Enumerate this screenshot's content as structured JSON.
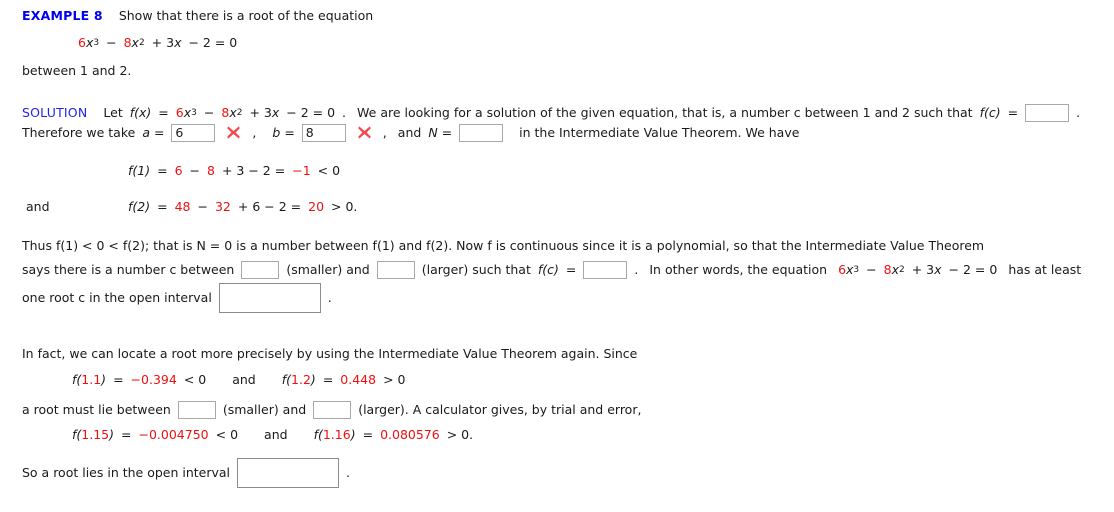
{
  "meta": {
    "colors": {
      "heading_blue": "#0000ee",
      "label_blue": "#2222ee",
      "accent_red": "#ee1111",
      "x_mark_red": "#f4484c",
      "input_border": "#a8a8a8",
      "text": "#1a1a1a",
      "background": "#ffffff"
    }
  },
  "example": {
    "label": "EXAMPLE 8",
    "prompt": "Show that there is a root of the equation",
    "equation": {
      "c1": "6",
      "t1": "x",
      "e1": "3",
      "op1": "−",
      "c2": "8",
      "t2": "x",
      "e2": "2",
      "op2": "+ 3",
      "t3": "x",
      "op3": "− 2 = 0"
    },
    "between": "between 1 and 2."
  },
  "solution": {
    "label": "SOLUTION",
    "let_text": "Let",
    "fx": "f(x)",
    "eq": "=",
    "looking_text": "We are looking for a solution of the given equation, that is, a number c between 1 and 2 such that",
    "fc": "f(c)",
    "fc_value": "",
    "trailing_period": ".",
    "therefore_text": "Therefore we take",
    "a_label": "a =",
    "a_value": "6",
    "a_status": "incorrect",
    "comma1": ",",
    "b_label": "b =",
    "b_value": "8",
    "b_status": "incorrect",
    "comma2": ",",
    "and_text": "and",
    "N_label": "N =",
    "N_value": "",
    "ivt_text": "in the Intermediate Value Theorem. We have"
  },
  "evaluations": {
    "f1": {
      "fn": "f(1)",
      "eq": "=",
      "terms": [
        "6",
        "−",
        "8",
        "+ 3 − 2 ="
      ],
      "result": "−1",
      "compare": "< 0"
    },
    "and_word": "and",
    "f2": {
      "fn": "f(2)",
      "eq": "=",
      "terms": [
        "48",
        "−",
        "32",
        "+ 6 − 2 ="
      ],
      "result": "20",
      "compare": "> 0."
    }
  },
  "thus": {
    "line1": "Thus  f(1) < 0 < f(2);  that is N = 0 is a number between  f(1)  and  f(2).  Now f is continuous since it is a polynomial, so that the Intermediate Value Theorem",
    "line2_a": "says there is a number c between",
    "smaller_value": "",
    "smaller_label": "(smaller) and",
    "larger_value": "",
    "larger_label": "(larger) such that",
    "fc": "f(c)",
    "eq": "=",
    "fc_value": "",
    "period": ".",
    "inwords": "In other words, the equation",
    "equation_tail": "has at least",
    "line3": "one root c in the open interval",
    "interval_value": "",
    "line3_period": "."
  },
  "infact": {
    "paragraph": "In fact, we can locate a root more precisely by using the Intermediate Value Theorem again. Since",
    "calc1": {
      "fn_open": "f(",
      "arg": "1.1",
      "fn_close": ")",
      "eq": "=",
      "value": "−0.394",
      "compare": "< 0"
    },
    "and_word": "and",
    "calc2": {
      "fn_open": "f(",
      "arg": "1.2",
      "fn_close": ")",
      "eq": "=",
      "value": "0.448",
      "compare": "> 0"
    },
    "lie_between": "a root must lie between",
    "smaller_value": "",
    "smaller_label": "(smaller) and",
    "larger_value": "",
    "larger_label": "(larger). A calculator gives, by trial and error,",
    "calc3": {
      "fn_open": "f(",
      "arg": "1.15",
      "fn_close": ")",
      "eq": "=",
      "value": "−0.004750",
      "compare": "< 0"
    },
    "and_word2": "and",
    "calc4": {
      "fn_open": "f(",
      "arg": "1.16",
      "fn_close": ")",
      "eq": "=",
      "value": "0.080576",
      "compare": "> 0."
    },
    "final_line": "So a root lies in the open interval",
    "final_value": "",
    "final_period": "."
  }
}
